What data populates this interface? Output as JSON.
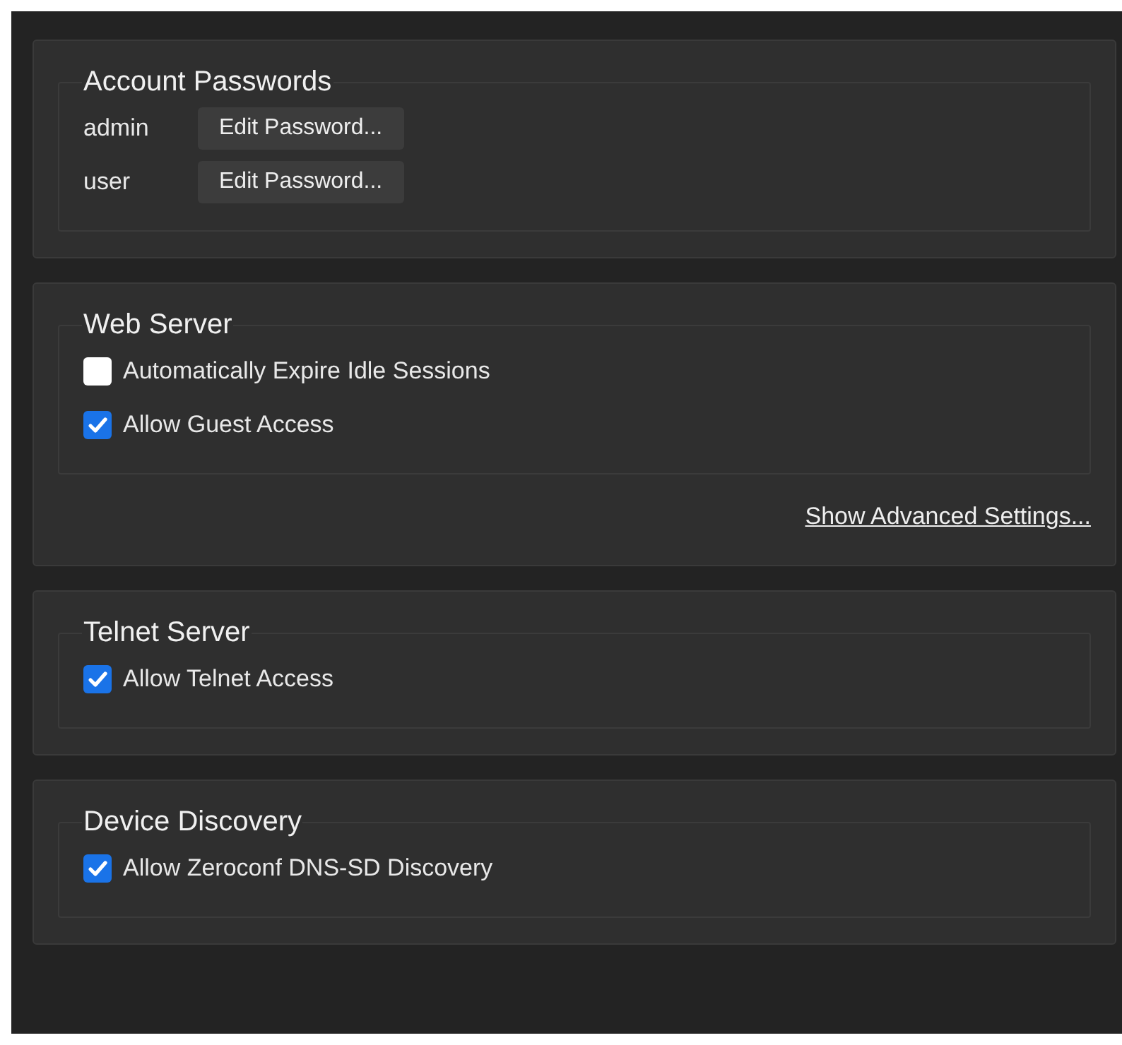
{
  "sections": [
    {
      "title": "Account Passwords",
      "items": [
        {
          "kind": "account",
          "label": "admin",
          "button": "Edit Password..."
        },
        {
          "kind": "account",
          "label": "user",
          "button": "Edit Password..."
        }
      ]
    },
    {
      "title": "Web Server",
      "items": [
        {
          "kind": "checkbox",
          "label": "Automatically Expire Idle Sessions",
          "checked": false
        },
        {
          "kind": "checkbox",
          "label": "Allow Guest Access",
          "checked": true
        }
      ],
      "link": "Show Advanced Settings..."
    },
    {
      "title": "Telnet Server",
      "items": [
        {
          "kind": "checkbox",
          "label": "Allow Telnet Access",
          "checked": true
        }
      ]
    },
    {
      "title": "Device Discovery",
      "items": [
        {
          "kind": "checkbox",
          "label": "Allow Zeroconf DNS-SD Discovery",
          "checked": true
        }
      ]
    }
  ]
}
